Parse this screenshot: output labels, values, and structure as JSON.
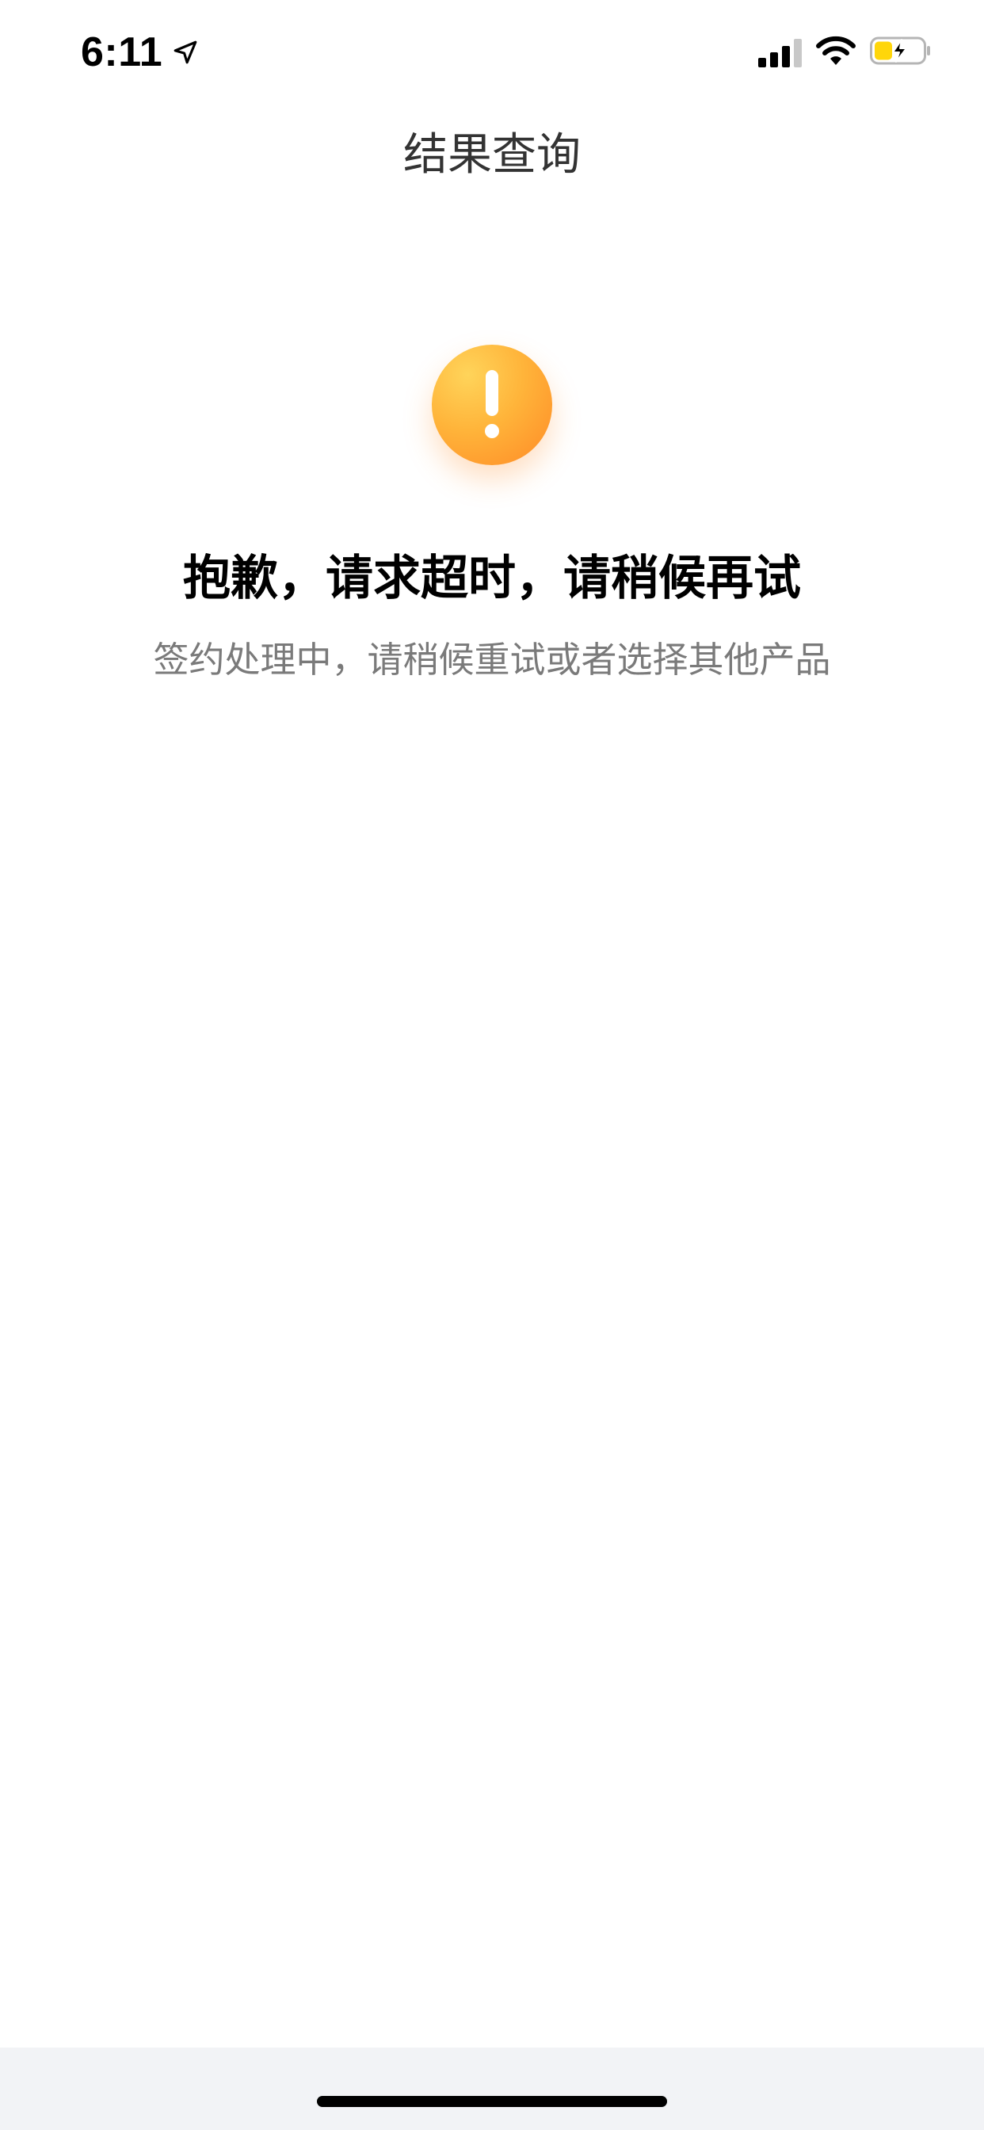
{
  "status_bar": {
    "time": "6:11",
    "icons": [
      "location-arrow-icon",
      "cellular-signal-icon",
      "wifi-icon",
      "battery-charging-icon"
    ],
    "battery_color": "#FFD60A"
  },
  "nav": {
    "title": "结果查询"
  },
  "result": {
    "icon": "warning-exclamation-icon",
    "icon_colors": [
      "#FFD45A",
      "#FF8A26"
    ],
    "title": "抱歉，请求超时，请稍候再试",
    "subtitle": "签约处理中，请稍候重试或者选择其他产品"
  }
}
